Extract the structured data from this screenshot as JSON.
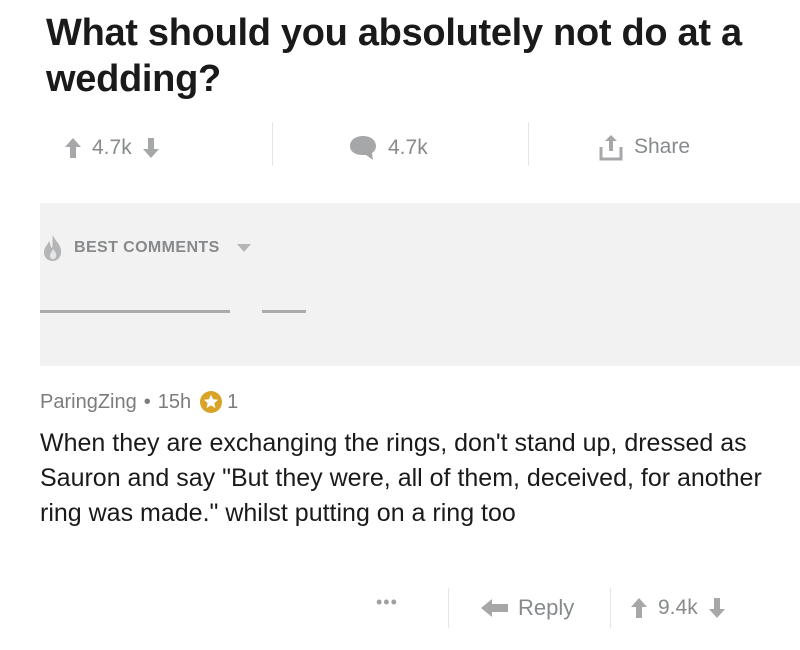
{
  "post": {
    "title": "What should you absolutely not do at a wedding?",
    "score": "4.7k",
    "comment_count": "4.7k",
    "share_label": "Share"
  },
  "sort": {
    "label": "BEST COMMENTS"
  },
  "comment": {
    "author": "ParingZing",
    "separator": "•",
    "age": "15h",
    "award_count": "1",
    "body": "When they are exchanging the rings, don't stand up, dressed as Sauron and say \"But they were, all of them, deceived, for another ring was made.\" whilst putting on a ring too",
    "more_label": "•••",
    "reply_label": "Reply",
    "score": "9.4k"
  },
  "icons": {
    "upvote": "arrow-up-icon",
    "downvote": "arrow-down-icon",
    "comments": "speech-bubble-icon",
    "share": "share-tray-icon",
    "sort": "flame-icon",
    "dropdown": "caret-down-icon",
    "award": "star-award-icon",
    "reply": "reply-arrow-icon"
  },
  "colors": {
    "text": "#1a1a1b",
    "muted": "#878a8c",
    "band": "#f2f2f2",
    "award": "#d8a326"
  }
}
